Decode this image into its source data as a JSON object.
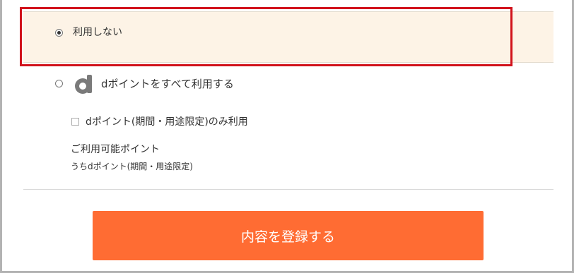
{
  "points_options": {
    "none": {
      "label": "利用しない",
      "selected": true
    },
    "all": {
      "label": "dポイントをすべて利用する",
      "selected": false,
      "icon": "d-point-logo-icon"
    }
  },
  "limited_checkbox": {
    "label": "dポイント(期間・用途限定)のみ利用",
    "checked": false
  },
  "available": {
    "title": "ご利用可能ポイント",
    "subtitle": "うちdポイント(期間・用途限定)"
  },
  "submit": {
    "label": "内容を登録する"
  },
  "colors": {
    "accent_button": "#ff6c33",
    "highlight_border": "#d1121b",
    "selected_row_bg": "#fdf3e6",
    "logo_gray": "#7a7a7a"
  }
}
